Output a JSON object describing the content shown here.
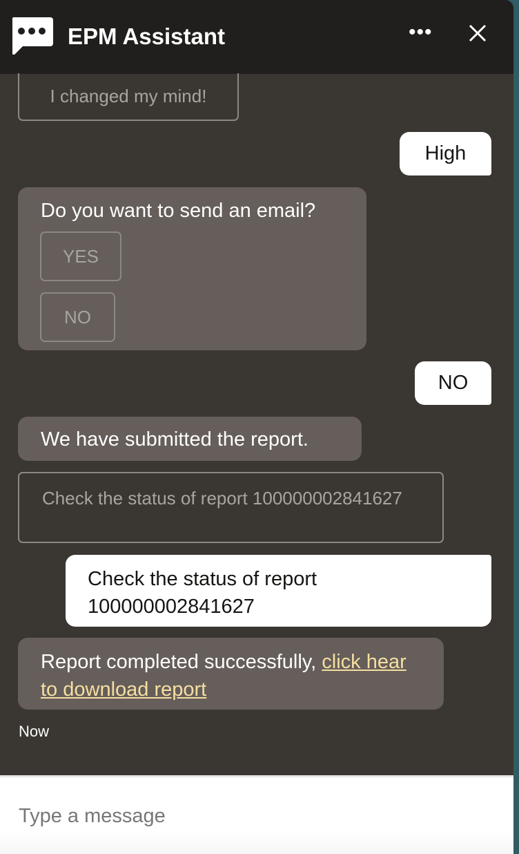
{
  "header": {
    "title": "EPM Assistant",
    "more_icon": "more-horizontal-icon",
    "close_icon": "close-icon",
    "logo_icon": "chat-bubble-icon"
  },
  "messages": {
    "changed_mind": "I changed my mind!",
    "user_high": "High",
    "email_prompt": "Do you want to send an email?",
    "yes": "YES",
    "no": "NO",
    "user_no": "NO",
    "submitted": "We have submitted the report.",
    "check_button": "Check the status of report 100000002841627",
    "user_check": "Check the status of report 100000002841627",
    "completed_text": "Report completed successfully, ",
    "completed_link": "click hear to download report",
    "timestamp": "Now"
  },
  "footer": {
    "placeholder": "Type a message"
  },
  "colors": {
    "header": "#201f1d",
    "body": "#3a3632",
    "bot_bubble": "#655e5a",
    "link": "#f6dfa0"
  }
}
